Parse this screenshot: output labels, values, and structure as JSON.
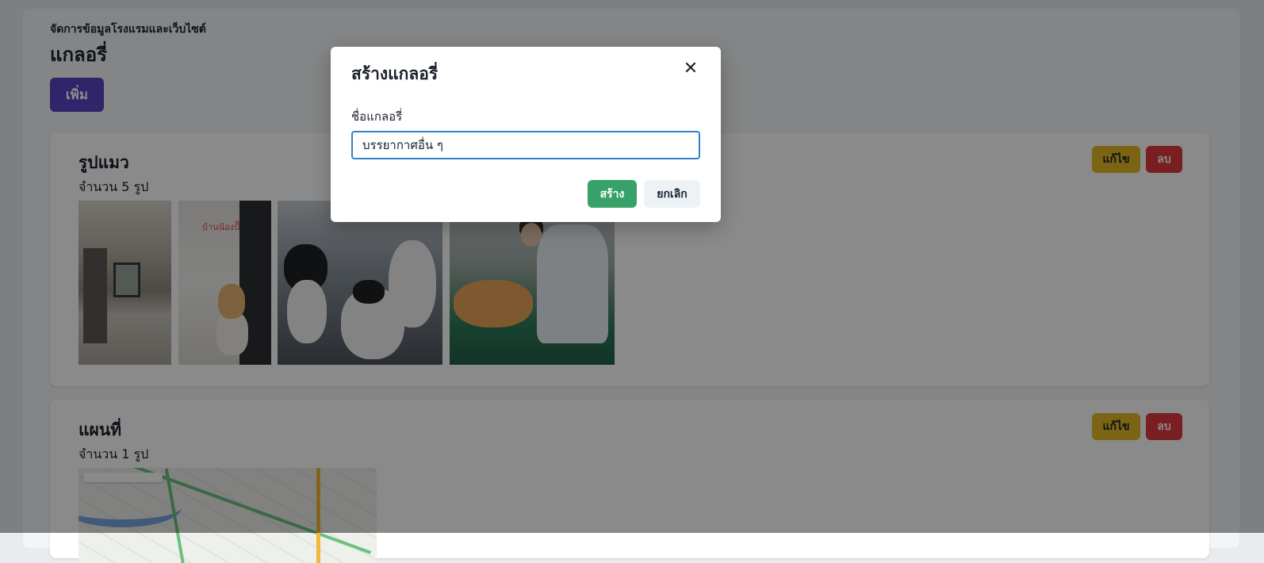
{
  "header": {
    "subtitle": "จัดการข้อมูลโรงแรมและเว็บไซต์",
    "title": "แกลอรี่",
    "add_label": "เพิ่ม"
  },
  "galleries": [
    {
      "name": "รูปแมว",
      "count_text": "จำนวน 5 รูป",
      "edit_label": "แก้ไข",
      "delete_label": "ลบ",
      "image_caption": "บ้านน้องปั๊"
    },
    {
      "name": "แผนที่",
      "count_text": "จำนวน 1 รูป",
      "edit_label": "แก้ไข",
      "delete_label": "ลบ"
    }
  ],
  "modal": {
    "title": "สร้างแกลอรี่",
    "close_icon": "close-icon",
    "field_label": "ชื่อแกลอรี่",
    "field_value": "บรรยากาศอื่น ๆ",
    "create_label": "สร้าง",
    "cancel_label": "ยกเลิก"
  },
  "colors": {
    "primary": "#5a44c4",
    "edit": "#e3b923",
    "delete": "#e0383e",
    "create": "#38a169",
    "focus": "#3182ce"
  }
}
